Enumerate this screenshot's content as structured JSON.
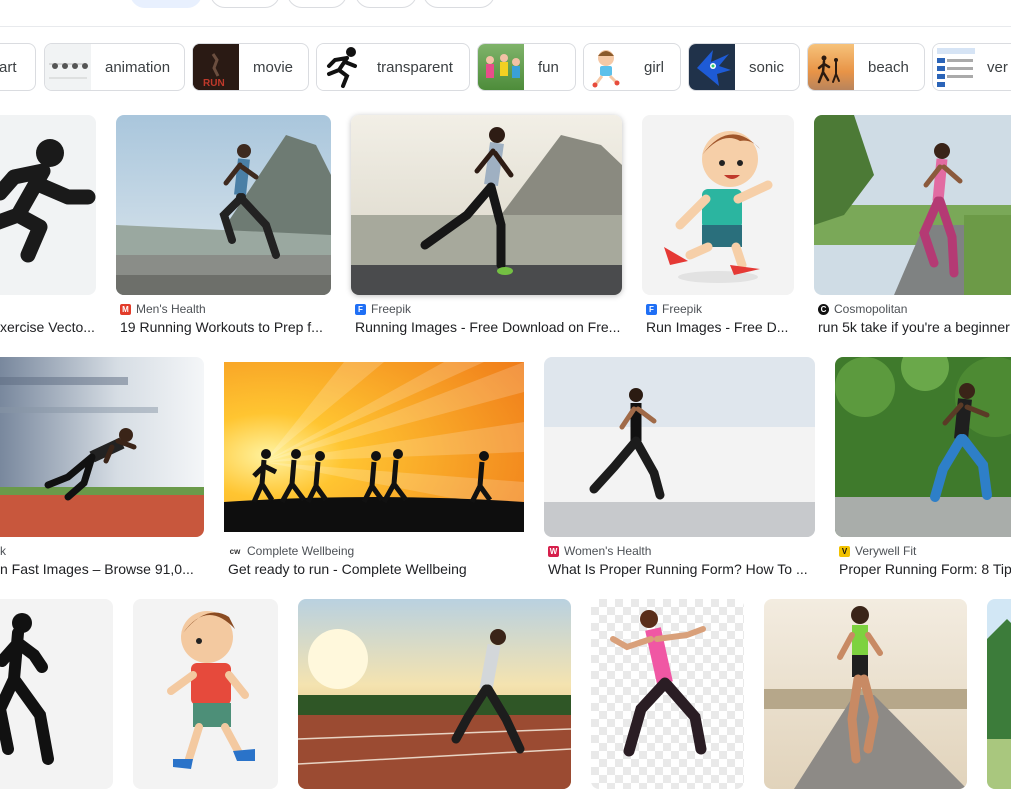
{
  "chips": [
    {
      "label": "art"
    },
    {
      "label": "animation"
    },
    {
      "label": "movie"
    },
    {
      "label": "transparent"
    },
    {
      "label": "fun"
    },
    {
      "label": "girl"
    },
    {
      "label": "sonic"
    },
    {
      "label": "beach"
    },
    {
      "label": "ver"
    }
  ],
  "row1": [
    {
      "source": "",
      "title": "xercise Vecto..."
    },
    {
      "source": "Men's Health",
      "title": "19 Running Workouts to Prep f..."
    },
    {
      "source": "Freepik",
      "title": "Running Images - Free Download on Fre..."
    },
    {
      "source": "Freepik",
      "title": "Run Images - Free D..."
    },
    {
      "source": "Cosmopolitan",
      "title": "run 5k take if you're a beginner"
    }
  ],
  "row2": [
    {
      "source": "k",
      "title": "n Fast Images – Browse 91,0..."
    },
    {
      "source": "Complete Wellbeing",
      "title": "Get ready to run - Complete Wellbeing"
    },
    {
      "source": "Women's Health",
      "title": "What Is Proper Running Form? How To ..."
    },
    {
      "source": "Verywell Fit",
      "title": "Proper Running Form: 8 Tip"
    }
  ],
  "colors": {
    "chip_border": "#dadce0",
    "text": "#202124",
    "source_text": "#4d5156",
    "active_tab": "#e8f0fe"
  }
}
